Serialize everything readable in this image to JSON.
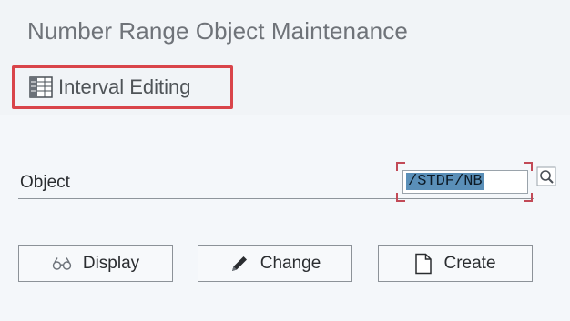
{
  "header": {
    "title": "Number Range Object Maintenance"
  },
  "toolbar": {
    "interval_editing_label": "Interval Editing",
    "interval_editing_icon": "interval-grid-icon",
    "highlight_color": "#d9444a"
  },
  "form": {
    "object_label": "Object",
    "object_value": "/STDF/NB",
    "value_help_icon": "search-icon"
  },
  "actions": {
    "display_label": "Display",
    "display_icon": "glasses-icon",
    "change_label": "Change",
    "change_icon": "pencil-icon",
    "create_label": "Create",
    "create_icon": "document-icon"
  }
}
